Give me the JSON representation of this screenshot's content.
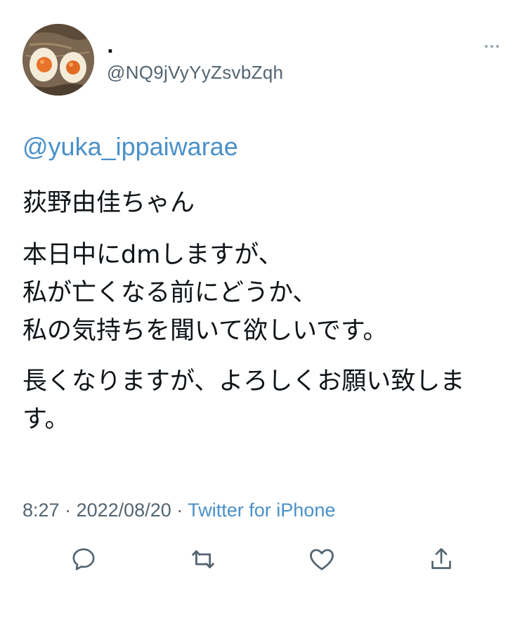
{
  "tweet": {
    "author": {
      "display_name": ".",
      "handle": "@NQ9jVyYyZsvbZqh",
      "avatar_icon": "avatar-ramen-eggs"
    },
    "mention": "@yuka_ippaiwarae",
    "paragraphs": [
      "荻野由佳ちゃん",
      "本日中にdmしますが、\n私が亡くなる前にどうか、\n私の気持ちを聞いて欲しいです。",
      "長くなりますが、よろしくお願い致します。"
    ],
    "time": "8:27",
    "separator": "·",
    "date": "2022/08/20",
    "source": "Twitter for iPhone"
  },
  "actions": {
    "reply_icon": "reply-icon",
    "retweet_icon": "retweet-icon",
    "like_icon": "heart-icon",
    "share_icon": "share-icon"
  },
  "colors": {
    "text": "#0f1419",
    "secondary": "#536471",
    "link": "#4a90c8",
    "icon": "#536471"
  }
}
